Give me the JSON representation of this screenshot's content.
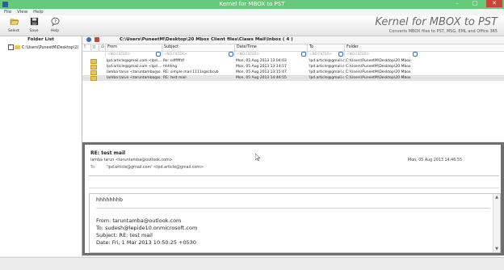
{
  "window": {
    "title": "Kernel for MBOX to PST",
    "minimize": "–",
    "maximize": "□",
    "close": "✕"
  },
  "menu": {
    "items": [
      "File",
      "View",
      "Help"
    ]
  },
  "toolbar": {
    "buttons": [
      {
        "label": "Select",
        "icon": "folder-open-icon"
      },
      {
        "label": "Save",
        "icon": "save-disk-icon"
      },
      {
        "label": "Help",
        "icon": "help-bubble-icon"
      }
    ],
    "brand_title": "Kernel for MBOX to PST",
    "brand_subtitle": "Converts MBOX files to PST, MSG, EML and Office 365"
  },
  "folder_list": {
    "header": "Folder List",
    "item": "C:\\Users\\PuneetM\\Desktop\\2("
  },
  "mail_list": {
    "path": "C:\\Users\\PuneetM\\Desktop\\20 Mbox Client files\\Claws Mail\\Inbox ( 4 )",
    "columns": [
      "From",
      "Subject",
      "Date/Time",
      "To",
      "Folder"
    ],
    "filter_placeholder": "<NO FILTER>",
    "rows": [
      {
        "from": "lpd.article@gmail.com <lpd....",
        "subject": "Re: sdfffffdf",
        "date": "Mon, 05 Aug 2013 13:04:03",
        "to": "'lpd.article@gmail.com'",
        "folder": "C:\\Users\\PuneetM\\Desktop\\20 Mbox"
      },
      {
        "from": "lpd.article@gmail.com <lpd....",
        "subject": "hhhhhg",
        "date": "Mon, 05 Aug 2013 13:14:57",
        "to": "'lpd.article@gmail.com'",
        "folder": "C:\\Users\\PuneetM\\Desktop\\20 Mbox"
      },
      {
        "from": "lamba tarun <taruntamba@o...",
        "subject": "RE: simple mail 1111sgscbcvb",
        "date": "Mon, 05 Aug 2013 13:15:47",
        "to": "'lpd.article@gmail.com'",
        "folder": "C:\\Users\\PuneetM\\Desktop\\20 Mbox"
      },
      {
        "from": "lamba tarun <taruntamba@o...",
        "subject": "RE: test mail",
        "date": "Mon, 05 Aug 2013 14:46:55",
        "to": "'lpd.article@gmail.com'",
        "folder": "C:\\Users\\PuneetM\\Desktop\\20 Mbox"
      }
    ],
    "selected_row": 3
  },
  "preview": {
    "subject": "RE: test mail",
    "from": "lamba tarun <taruntamba@outlook.com>",
    "date": "Mon, 05 Aug 2013 14:46:55",
    "to_label": "To:",
    "to": "'lpd.article@gmail.com' <lpd.article@gmail.com>",
    "body_lines": [
      "hhhhhhhb",
      "From: taruntamba@outlook.com",
      "To: sudesh@lepide10.onmicrosoft.com",
      "Subject: RE: test mail",
      "Date: Fri, 1 Mar 2013 10:50:25 +0530"
    ]
  },
  "colors": {
    "titlebar": "#66c97a",
    "close": "#c7453a",
    "selected_row": "#e3e3e3",
    "folder_icon": "#e8c45c"
  }
}
